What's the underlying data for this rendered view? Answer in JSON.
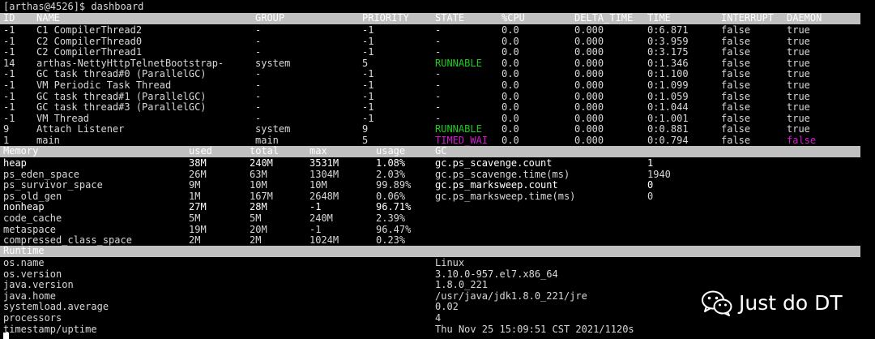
{
  "prompt": "[arthas@4526]$ dashboard",
  "threads": {
    "headers": [
      "ID",
      "NAME",
      "GROUP",
      "PRIORITY",
      "STATE",
      "%CPU",
      "DELTA_TIME",
      "TIME",
      "INTERRUPT",
      "DAEMON"
    ],
    "rows": [
      {
        "id": "-1",
        "name": "C1 CompilerThread2",
        "group": "-",
        "priority": "-1",
        "state": "-",
        "cpu": "0.0",
        "delta": "0.000",
        "time": "0:6.871",
        "interrupt": "false",
        "daemon": "true"
      },
      {
        "id": "-1",
        "name": "C2 CompilerThread0",
        "group": "-",
        "priority": "-1",
        "state": "-",
        "cpu": "0.0",
        "delta": "0.000",
        "time": "0:3.959",
        "interrupt": "false",
        "daemon": "true"
      },
      {
        "id": "-1",
        "name": "C2 CompilerThread1",
        "group": "-",
        "priority": "-1",
        "state": "-",
        "cpu": "0.0",
        "delta": "0.000",
        "time": "0:3.175",
        "interrupt": "false",
        "daemon": "true"
      },
      {
        "id": "14",
        "name": "arthas-NettyHttpTelnetBootstrap-",
        "group": "system",
        "priority": "5",
        "state": "RUNNABLE",
        "cpu": "0.0",
        "delta": "0.000",
        "time": "0:1.346",
        "interrupt": "false",
        "daemon": "true"
      },
      {
        "id": "-1",
        "name": "GC task thread#0 (ParallelGC)",
        "group": "-",
        "priority": "-1",
        "state": "-",
        "cpu": "0.0",
        "delta": "0.000",
        "time": "0:1.100",
        "interrupt": "false",
        "daemon": "true"
      },
      {
        "id": "-1",
        "name": "VM Periodic Task Thread",
        "group": "-",
        "priority": "-1",
        "state": "-",
        "cpu": "0.0",
        "delta": "0.000",
        "time": "0:1.099",
        "interrupt": "false",
        "daemon": "true"
      },
      {
        "id": "-1",
        "name": "GC task thread#1 (ParallelGC)",
        "group": "-",
        "priority": "-1",
        "state": "-",
        "cpu": "0.0",
        "delta": "0.000",
        "time": "0:1.059",
        "interrupt": "false",
        "daemon": "true"
      },
      {
        "id": "-1",
        "name": "GC task thread#3 (ParallelGC)",
        "group": "-",
        "priority": "-1",
        "state": "-",
        "cpu": "0.0",
        "delta": "0.000",
        "time": "0:1.044",
        "interrupt": "false",
        "daemon": "true"
      },
      {
        "id": "-1",
        "name": "VM Thread",
        "group": "-",
        "priority": "-1",
        "state": "-",
        "cpu": "0.0",
        "delta": "0.000",
        "time": "0:1.001",
        "interrupt": "false",
        "daemon": "true"
      },
      {
        "id": "9",
        "name": "Attach Listener",
        "group": "system",
        "priority": "9",
        "state": "RUNNABLE",
        "cpu": "0.0",
        "delta": "0.000",
        "time": "0:0.881",
        "interrupt": "false",
        "daemon": "true"
      },
      {
        "id": "1",
        "name": "main",
        "group": "main",
        "priority": "5",
        "state": "TIMED_WAI",
        "cpu": "0.0",
        "delta": "0.000",
        "time": "0:0.794",
        "interrupt": "false",
        "daemon": "false"
      }
    ]
  },
  "memory": {
    "headers": [
      "Memory",
      "used",
      "total",
      "max",
      "usage",
      "GC"
    ],
    "rows": [
      {
        "name": "heap",
        "used": "38M",
        "total": "240M",
        "max": "3531M",
        "usage": "1.08%",
        "bright": true
      },
      {
        "name": "ps_eden_space",
        "used": "26M",
        "total": "63M",
        "max": "1304M",
        "usage": "2.03%",
        "bright": false
      },
      {
        "name": "ps_survivor_space",
        "used": "9M",
        "total": "10M",
        "max": "10M",
        "usage": "99.89%",
        "bright": false
      },
      {
        "name": "ps_old_gen",
        "used": "1M",
        "total": "167M",
        "max": "2648M",
        "usage": "0.06%",
        "bright": false
      },
      {
        "name": "nonheap",
        "used": "27M",
        "total": "28M",
        "max": "-1",
        "usage": "96.71%",
        "bright": true
      },
      {
        "name": "code_cache",
        "used": "5M",
        "total": "5M",
        "max": "240M",
        "usage": "2.39%",
        "bright": false
      },
      {
        "name": "metaspace",
        "used": "19M",
        "total": "20M",
        "max": "-1",
        "usage": "96.47%",
        "bright": false
      },
      {
        "name": "compressed_class_space",
        "used": "2M",
        "total": "2M",
        "max": "1024M",
        "usage": "0.23%",
        "bright": false
      }
    ]
  },
  "gc": {
    "rows": [
      {
        "name": "gc.ps_scavenge.count",
        "value": "1",
        "bright": true
      },
      {
        "name": "gc.ps_scavenge.time(ms)",
        "value": "1940",
        "bright": false
      },
      {
        "name": "gc.ps_marksweep.count",
        "value": "0",
        "bright": true
      },
      {
        "name": "gc.ps_marksweep.time(ms)",
        "value": "0",
        "bright": false
      }
    ]
  },
  "runtime": {
    "header": "Runtime",
    "rows": [
      {
        "key": "os.name",
        "value": "Linux"
      },
      {
        "key": "os.version",
        "value": "3.10.0-957.el7.x86_64"
      },
      {
        "key": "java.version",
        "value": "1.8.0_221"
      },
      {
        "key": "java.home",
        "value": "/usr/java/jdk1.8.0_221/jre"
      },
      {
        "key": "systemload.average",
        "value": "0.02"
      },
      {
        "key": "processors",
        "value": "4"
      },
      {
        "key": "timestamp/uptime",
        "value": "Thu Nov 25 15:09:51 CST 2021/1120s"
      }
    ]
  },
  "watermark": {
    "icon": "wechat-icon",
    "text": "Just do DT"
  },
  "colors": {
    "background": "#000000",
    "text": "#d8d8d8",
    "header_bg": "#c0c0c0",
    "header_text": "#ffffff",
    "runnable": "#1ecb1e",
    "timed_waiting": "#d11bd1"
  }
}
